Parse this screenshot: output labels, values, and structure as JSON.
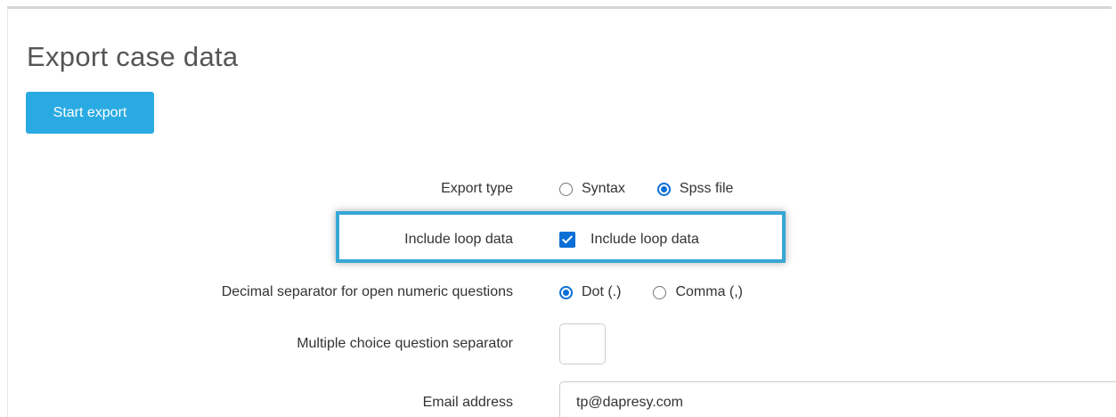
{
  "page": {
    "title": "Export case data"
  },
  "toolbar": {
    "start_export_label": "Start export"
  },
  "form": {
    "export_type": {
      "label": "Export type",
      "options": [
        {
          "label": "Syntax",
          "checked": false
        },
        {
          "label": "Spss file",
          "checked": true
        }
      ]
    },
    "include_loop_data": {
      "label": "Include loop data",
      "checkbox_label": "Include loop data",
      "checked": true
    },
    "decimal_separator": {
      "label": "Decimal separator for open numeric questions",
      "options": [
        {
          "label": "Dot (.)",
          "checked": true
        },
        {
          "label": "Comma (,)",
          "checked": false
        }
      ]
    },
    "multiple_choice_separator": {
      "label": "Multiple choice question separator",
      "value": ""
    },
    "email": {
      "label": "Email address",
      "value": "tp@dapresy.com"
    }
  },
  "colors": {
    "primary_button": "#2aaae2",
    "highlight_border": "#37a7d6",
    "control_accent": "#0a6fd6"
  }
}
